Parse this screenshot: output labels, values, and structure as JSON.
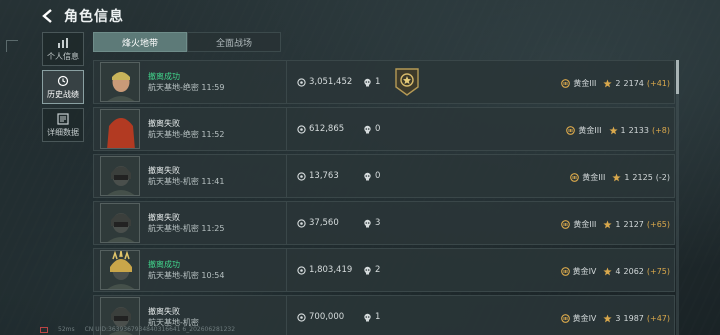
{
  "header": {
    "title": "角色信息"
  },
  "sidebar": [
    {
      "label": "个人信息",
      "icon": "bar-chart-icon",
      "active": false
    },
    {
      "label": "历史战绩",
      "icon": "history-icon",
      "active": true
    },
    {
      "label": "详细数据",
      "icon": "data-icon",
      "active": false
    }
  ],
  "tabs": [
    {
      "label": "烽火地带",
      "active": true
    },
    {
      "label": "全面战场",
      "active": false
    }
  ],
  "records": [
    {
      "result": "撤离成功",
      "status": "success",
      "map": "航天基地-绝密 11:59",
      "value": "3,051,452",
      "kills": "1",
      "medal": true,
      "tier": "黄金III",
      "stars": "2",
      "score": "2174",
      "delta": "(+41)",
      "avatar": "male-bandana"
    },
    {
      "result": "撤离失败",
      "status": "fail",
      "map": "航天基地-绝密 11:52",
      "value": "612,865",
      "kills": "0",
      "medal": false,
      "tier": "黄金III",
      "stars": "1",
      "score": "2133",
      "delta": "(+8)",
      "avatar": "female-redhair"
    },
    {
      "result": "撤离失败",
      "status": "fail",
      "map": "航天基地-机密 11:41",
      "value": "13,763",
      "kills": "0",
      "medal": false,
      "tier": "黄金III",
      "stars": "1",
      "score": "2125",
      "delta": "(-2)",
      "avatar": "helmet-mask"
    },
    {
      "result": "撤离失败",
      "status": "fail",
      "map": "航天基地-机密 11:25",
      "value": "37,560",
      "kills": "3",
      "medal": false,
      "tier": "黄金III",
      "stars": "1",
      "score": "2127",
      "delta": "(+65)",
      "avatar": "helmet-mask"
    },
    {
      "result": "撤离成功",
      "status": "success",
      "map": "航天基地-机密 10:54",
      "value": "1,803,419",
      "kills": "2",
      "medal": false,
      "tier": "黄金IV",
      "stars": "4",
      "score": "2062",
      "delta": "(+75)",
      "avatar": "gold-helmet"
    },
    {
      "result": "撤离失败",
      "status": "fail",
      "map": "航天基地-机密",
      "value": "700,000",
      "kills": "1",
      "medal": false,
      "tier": "黄金IV",
      "stars": "3",
      "score": "1987",
      "delta": "(+47)",
      "avatar": "helmet-mask"
    }
  ],
  "footer": {
    "ping": "52ms",
    "uid": "CN UID:3639367934840316641 6_202606281232"
  },
  "colors": {
    "success": "#41d48b",
    "accent": "#5d7a78",
    "gold": "#d9a84c"
  }
}
